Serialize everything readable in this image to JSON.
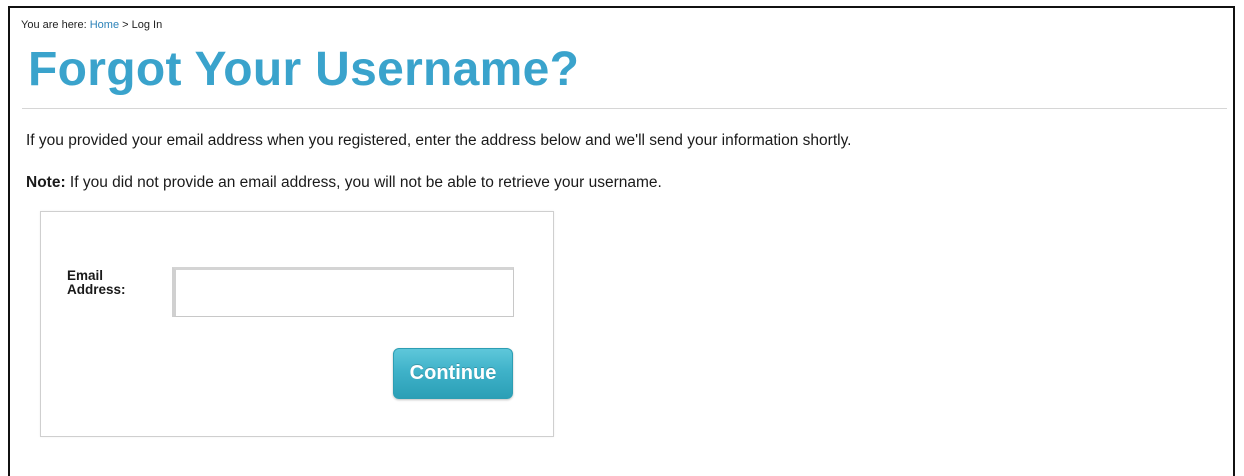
{
  "breadcrumb": {
    "prefix": "You are here:",
    "home_label": "Home",
    "separator": ">",
    "current": "Log In"
  },
  "page": {
    "title": "Forgot Your Username?",
    "intro": "If you provided your email address when you registered, enter the address below and we'll send your information shortly.",
    "note_label": "Note:",
    "note_text": "If you did not provide an email address, you will not be able to retrieve your username."
  },
  "form": {
    "email_label_line1": "Email",
    "email_label_line2": "Address:",
    "email_value": "",
    "continue_label": "Continue"
  },
  "colors": {
    "title": "#3aa3cc",
    "link": "#2b82b8",
    "button": "#3fb2c9"
  }
}
